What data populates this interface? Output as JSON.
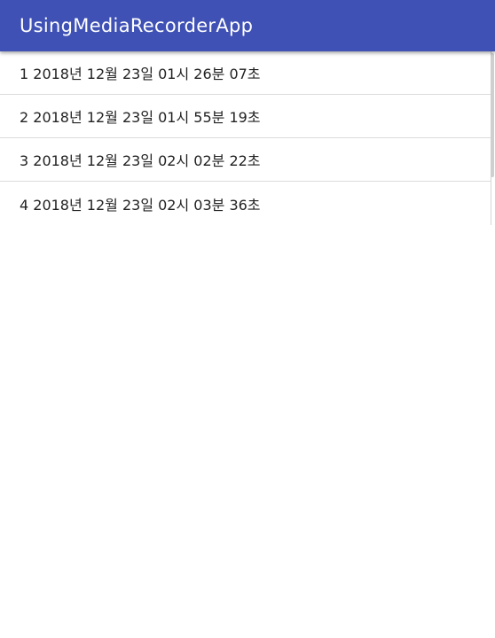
{
  "app_bar": {
    "title": "UsingMediaRecorderApp",
    "background_color": "#3f51b5"
  },
  "recordings": [
    {
      "label": "1 2018년 12월 23일 01시 26분 07초"
    },
    {
      "label": "2 2018년 12월 23일 01시 55분 19초"
    },
    {
      "label": "3 2018년 12월 23일 02시 02분 22초"
    },
    {
      "label": "4 2018년 12월 23일 02시 03분 36초"
    }
  ]
}
